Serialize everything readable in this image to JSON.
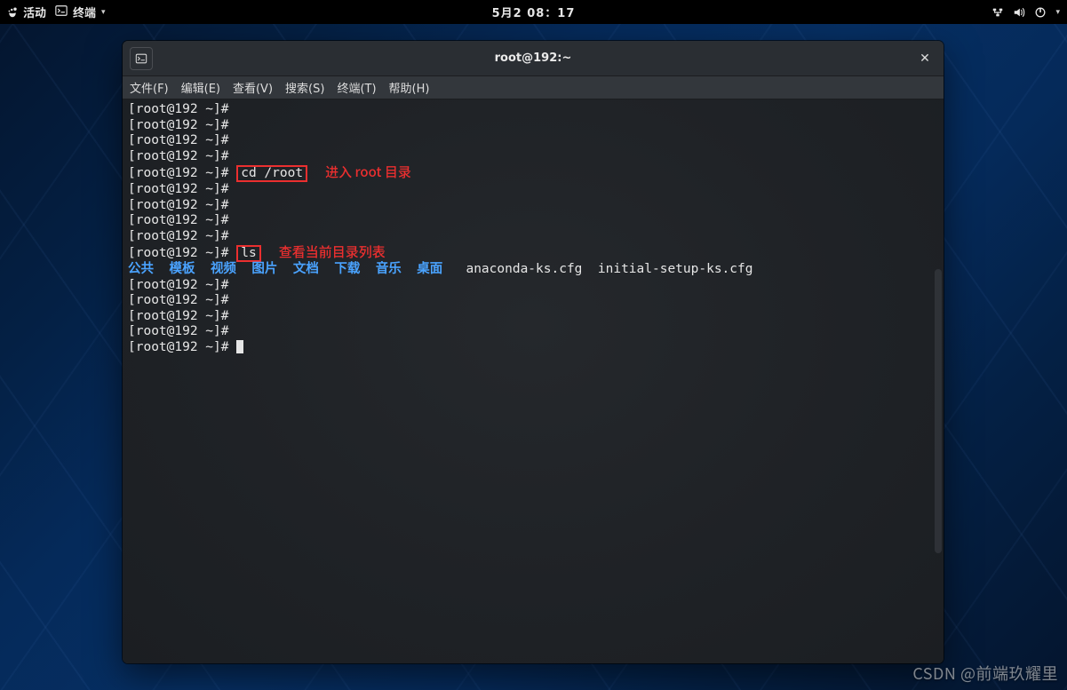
{
  "topbar": {
    "activities": "活动",
    "app_name": "终端",
    "clock": "5月2 08：17"
  },
  "window": {
    "title": "root@192:~",
    "menus": {
      "file": "文件(F)",
      "edit": "编辑(E)",
      "view": "查看(V)",
      "search": "搜索(S)",
      "terminal": "终端(T)",
      "help": "帮助(H)"
    }
  },
  "terminal": {
    "prompt": "[root@192 ~]# ",
    "cmd_cd": "cd /root",
    "cmd_ls": "ls",
    "note_cd": "进入 root 目录",
    "note_ls": "查看当前目录列表",
    "ls_dirs": [
      "公共",
      "模板",
      "视频",
      "图片",
      "文档",
      "下载",
      "音乐",
      "桌面"
    ],
    "ls_files": [
      "anaconda-ks.cfg",
      "initial-setup-ks.cfg"
    ]
  },
  "watermark": "CSDN @前端玖耀里"
}
